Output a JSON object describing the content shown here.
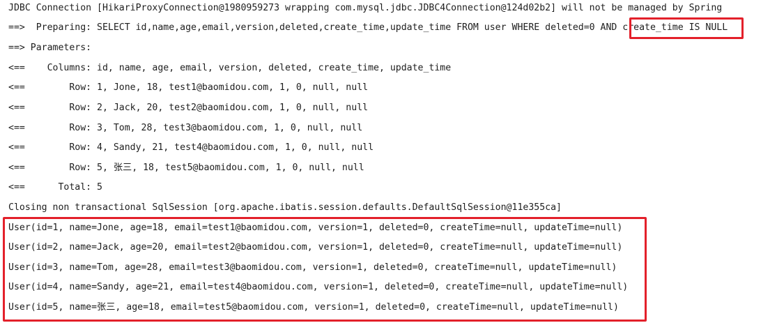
{
  "console": {
    "lines": [
      "JDBC Connection [HikariProxyConnection@1980959273 wrapping com.mysql.jdbc.JDBC4Connection@124d02b2] will not be managed by Spring",
      "==>  Preparing: SELECT id,name,age,email,version,deleted,create_time,update_time FROM user WHERE deleted=0 AND ",
      "==> Parameters: ",
      "<==    Columns: id, name, age, email, version, deleted, create_time, update_time",
      "<==        Row: 1, Jone, 18, test1@baomidou.com, 1, 0, null, null",
      "<==        Row: 2, Jack, 20, test2@baomidou.com, 1, 0, null, null",
      "<==        Row: 3, Tom, 28, test3@baomidou.com, 1, 0, null, null",
      "<==        Row: 4, Sandy, 21, test4@baomidou.com, 1, 0, null, null",
      "<==        Row: 5, 张三, 18, test5@baomidou.com, 1, 0, null, null",
      "<==      Total: 5",
      "Closing non transactional SqlSession [org.apache.ibatis.session.defaults.DefaultSqlSession@11e355ca]",
      "User(id=1, name=Jone, age=18, email=test1@baomidou.com, version=1, deleted=0, createTime=null, updateTime=null)",
      "User(id=2, name=Jack, age=20, email=test2@baomidou.com, version=1, deleted=0, createTime=null, updateTime=null)",
      "User(id=3, name=Tom, age=28, email=test3@baomidou.com, version=1, deleted=0, createTime=null, updateTime=null)",
      "User(id=4, name=Sandy, age=21, email=test4@baomidou.com, version=1, deleted=0, createTime=null, updateTime=null)",
      "User(id=5, name=张三, age=18, email=test5@baomidou.com, version=1, deleted=0, createTime=null, updateTime=null)"
    ],
    "highlighted_condition": "create_time IS NULL",
    "highlight_color": "#e3202a",
    "text_color": "#1e1e1e",
    "background_color": "#ffffff"
  }
}
